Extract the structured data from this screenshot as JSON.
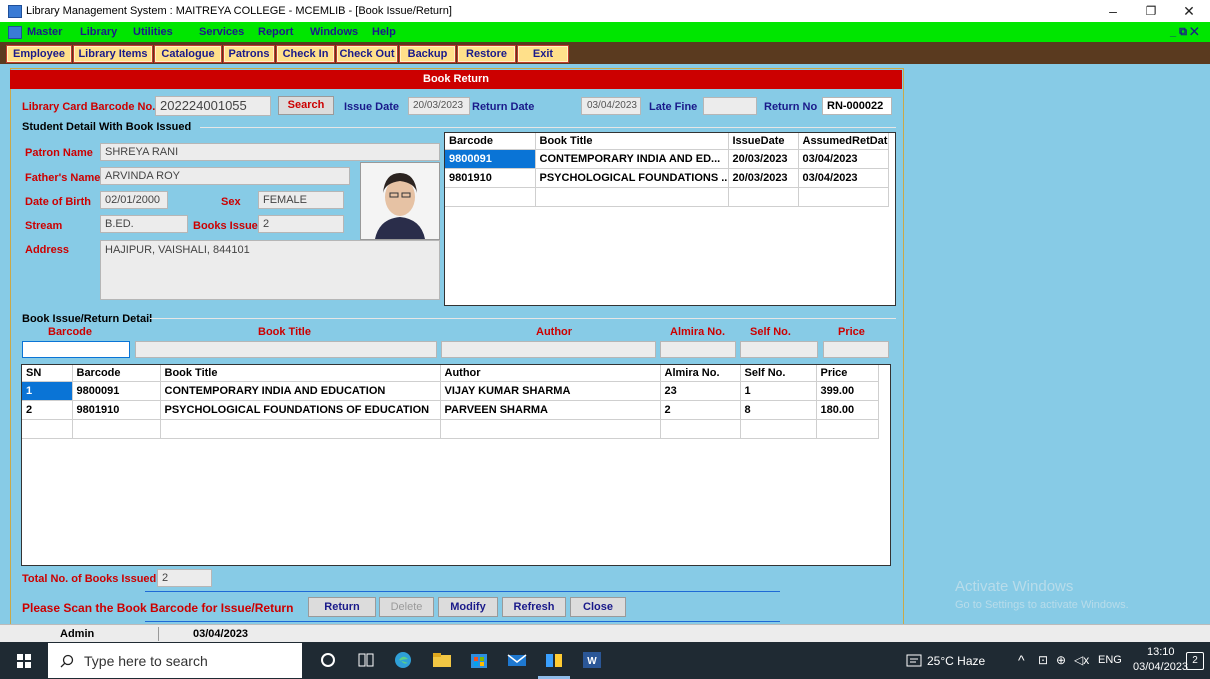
{
  "window": {
    "title": "Library Management System : MAITREYA COLLEGE - MCEMLIB - [Book Issue/Return]",
    "min": "–",
    "max": "❐",
    "close": "✕"
  },
  "menu": [
    "Master",
    "Library",
    "Utilities",
    "Services",
    "Report",
    "Windows",
    "Help"
  ],
  "menu_right": "_ ⧉ ✕",
  "toolbar": [
    "Employee",
    "Library Items",
    "Catalogue",
    "Patrons",
    "Check In",
    "Check Out",
    "Backup",
    "Restore",
    "Exit"
  ],
  "form": {
    "header": "Book Return",
    "card_label": "Library Card Barcode No.",
    "card_value": "202224001055",
    "search": "Search",
    "issue_date_label": "Issue Date",
    "issue_date": "20/03/2023",
    "return_date_label": "Return Date",
    "return_date": "03/04/2023",
    "late_fine_label": "Late Fine",
    "late_fine": "",
    "return_no_label": "Return No",
    "return_no": "RN-000022",
    "student_group": "Student Detail With Book Issued",
    "patron_name_label": "Patron Name",
    "patron_name": "SHREYA RANI",
    "father_label": "Father's Name",
    "father": "ARVINDA ROY",
    "dob_label": "Date of Birth",
    "dob": "02/01/2000",
    "sex_label": "Sex",
    "sex": "FEMALE",
    "stream_label": "Stream",
    "stream": "B.ED.",
    "books_issued_label": "Books Issued",
    "books_issued": "2",
    "address_label": "Address",
    "address": "HAJIPUR, VAISHALI, 844101"
  },
  "issued_grid": {
    "headers": [
      "Barcode",
      "Book Title",
      "IssueDate",
      "AssumedRetDat"
    ],
    "rows": [
      [
        "9800091",
        "CONTEMPORARY INDIA AND ED...",
        "20/03/2023",
        "03/04/2023"
      ],
      [
        "9801910",
        "PSYCHOLOGICAL FOUNDATIONS ...",
        "20/03/2023",
        "03/04/2023"
      ]
    ]
  },
  "detail": {
    "group": "Book Issue/Return Detail",
    "headers": [
      "Barcode",
      "Book Title",
      "Author",
      "Almira No.",
      "Self No.",
      "Price"
    ]
  },
  "detail_grid": {
    "headers": [
      "SN",
      "Barcode",
      "Book Title",
      "Author",
      "Almira No.",
      "Self No.",
      "Price"
    ],
    "rows": [
      [
        "1",
        "9800091",
        "CONTEMPORARY INDIA AND EDUCATION",
        "VIJAY KUMAR SHARMA",
        "23",
        "1",
        "399.00"
      ],
      [
        "2",
        "9801910",
        "PSYCHOLOGICAL FOUNDATIONS OF EDUCATION",
        "PARVEEN SHARMA",
        "2",
        "8",
        "180.00"
      ]
    ]
  },
  "footer": {
    "total_label": "Total No. of Books Issued",
    "total_value": "2",
    "scan_msg": "Please Scan the Book Barcode for Issue/Return",
    "buttons": [
      "Return",
      "Delete",
      "Modify",
      "Refresh",
      "Close"
    ]
  },
  "status": {
    "user": "Admin",
    "date": "03/04/2023"
  },
  "watermark": {
    "line1": "Activate Windows",
    "line2": "Go to Settings to activate Windows."
  },
  "taskbar": {
    "search": "Type here to search",
    "weather": "25°C Haze",
    "lang": "ENG",
    "time": "13:10",
    "date": "03/04/2023",
    "notif": "2"
  },
  "colors": {
    "menubar": "#00e600",
    "header": "#cc0000",
    "panel": "#87cbe6",
    "selection": "#0a74d6"
  }
}
